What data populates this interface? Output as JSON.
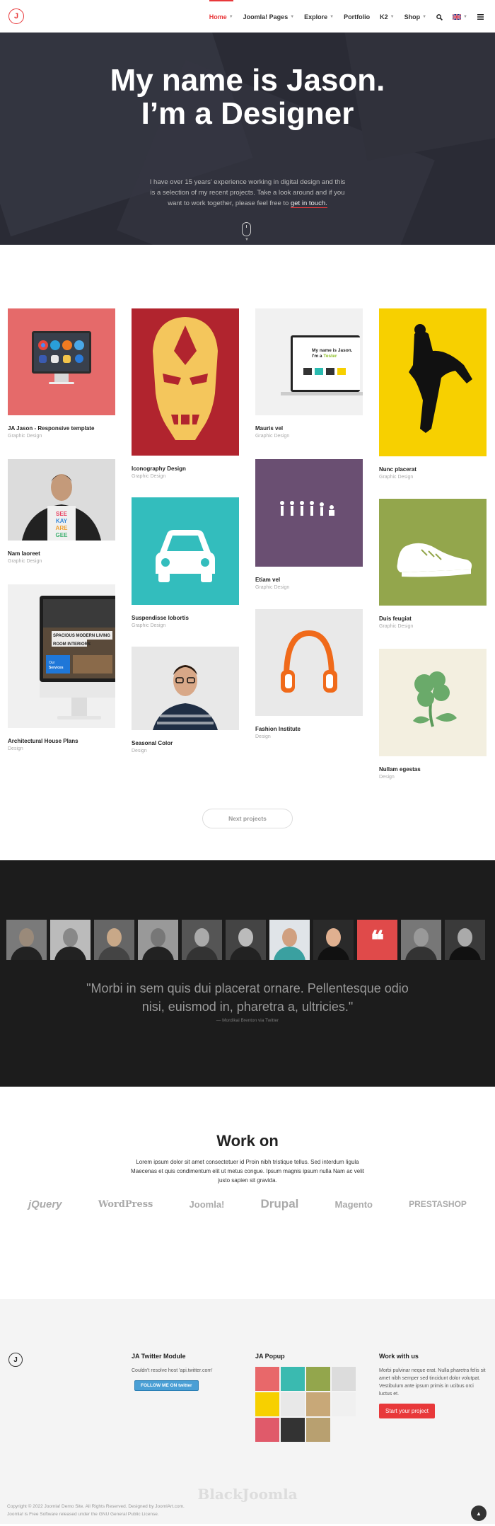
{
  "header": {
    "logo_letter": "J",
    "nav": [
      {
        "label": "Home",
        "active": true,
        "caret": true
      },
      {
        "label": "Joomla! Pages",
        "caret": true
      },
      {
        "label": "Explore",
        "caret": true
      },
      {
        "label": "Portfolio",
        "caret": false
      },
      {
        "label": "K2",
        "caret": true
      },
      {
        "label": "Shop",
        "caret": true
      }
    ],
    "icons": [
      "search-icon",
      "flag-uk-icon",
      "menu-icon"
    ]
  },
  "hero": {
    "title_line1": "My name is Jason.",
    "title_line2": "I’m a Designer",
    "text": "I have over 15 years' experience working in digital design and this is a selection of my recent projects. Take a look around and if you want to work together, please feel free to",
    "link": "get in touch."
  },
  "portfolio": {
    "items": [
      {
        "title": "JA Jason - Responsive template",
        "category": "Graphic Design",
        "bg": "#e56a6a"
      },
      {
        "title": "Iconography Design",
        "category": "Graphic Design",
        "bg": "#b1242e"
      },
      {
        "title": "Mauris vel",
        "category": "Graphic Design",
        "bg": "#f1f1f1"
      },
      {
        "title": "Nunc placerat",
        "category": "Graphic Design",
        "bg": "#f7d000"
      },
      {
        "title": "Nam laoreet",
        "category": "Graphic Design",
        "bg": "#d8d8d8"
      },
      {
        "title": "Suspendisse lobortis",
        "category": "Graphic Design",
        "bg": "#33bdbd"
      },
      {
        "title": "Etiam vel",
        "category": "Graphic Design",
        "bg": "#6a4f72"
      },
      {
        "title": "Duis feugiat",
        "category": "Graphic Design",
        "bg": "#93a64c"
      },
      {
        "title": "Architectural House Plans",
        "category": "Design",
        "bg": "#f0f0f0"
      },
      {
        "title": "Seasonal Color",
        "category": "Design",
        "bg": "#e8e8e8"
      },
      {
        "title": "Fashion Institute",
        "category": "Design",
        "bg": "#e9e9e9"
      },
      {
        "title": "Nullam egestas",
        "category": "Design",
        "bg": "#f3efe0"
      }
    ],
    "mock_text_1": "My name is Jason.",
    "mock_text_2": "I'm a",
    "mock_text_3": "Tester",
    "mock_room_1": "SPACIOUS MODERN LIVING",
    "mock_room_2": "ROOM INTERIORS",
    "mock_services": "Services",
    "shirt_text": "SEE EMM KAY ARE GEE",
    "next_label": "Next projects"
  },
  "testimonial": {
    "quote": "\"Morbi in sem quis dui placerat ornare. Pellentesque odio nisi, euismod in, pharetra a, ultricies.\"",
    "cite": "— Mordikai Brenton via Twitter",
    "quote_mark": "❝"
  },
  "workon": {
    "title": "Work on",
    "text": "Lorem ipsum dolor sit amet consectetuer id Proin nibh tristique tellus. Sed interdum ligula Maecenas et quis condimentum elit ut metus congue. Ipsum magnis ipsum nulla Nam ac velit justo sapien sit gravida.",
    "logos": [
      "jQuery",
      "WordPress",
      "Joomla!",
      "Drupal",
      "Magento",
      "PRESTASHOP"
    ]
  },
  "footer": {
    "logo_letter": "J",
    "twitter_title": "JA Twitter Module",
    "twitter_error": "Couldn't resolve host 'api.twitter.com'",
    "twitter_button": "FOLLOW ME ON twitter",
    "popup_title": "JA Popup",
    "work_title": "Work with us",
    "work_text": "Morbi pulvinar neque erat. Nulla pharetra felis sit amet nibh semper sed tincidunt dolor volutpat. Vestibulum ante ipsum primis in ucibus orci luctus et.",
    "work_button": "Start your project",
    "watermark": "BlackJoomla",
    "copyright": "Copyright © 2022 Joomla! Demo Site. All Rights Reserved. Designed by",
    "copyright_link": "JoomlArt.com.",
    "license": "Joomla! is Free Software released under the",
    "license_link": "GNU General Public License."
  }
}
